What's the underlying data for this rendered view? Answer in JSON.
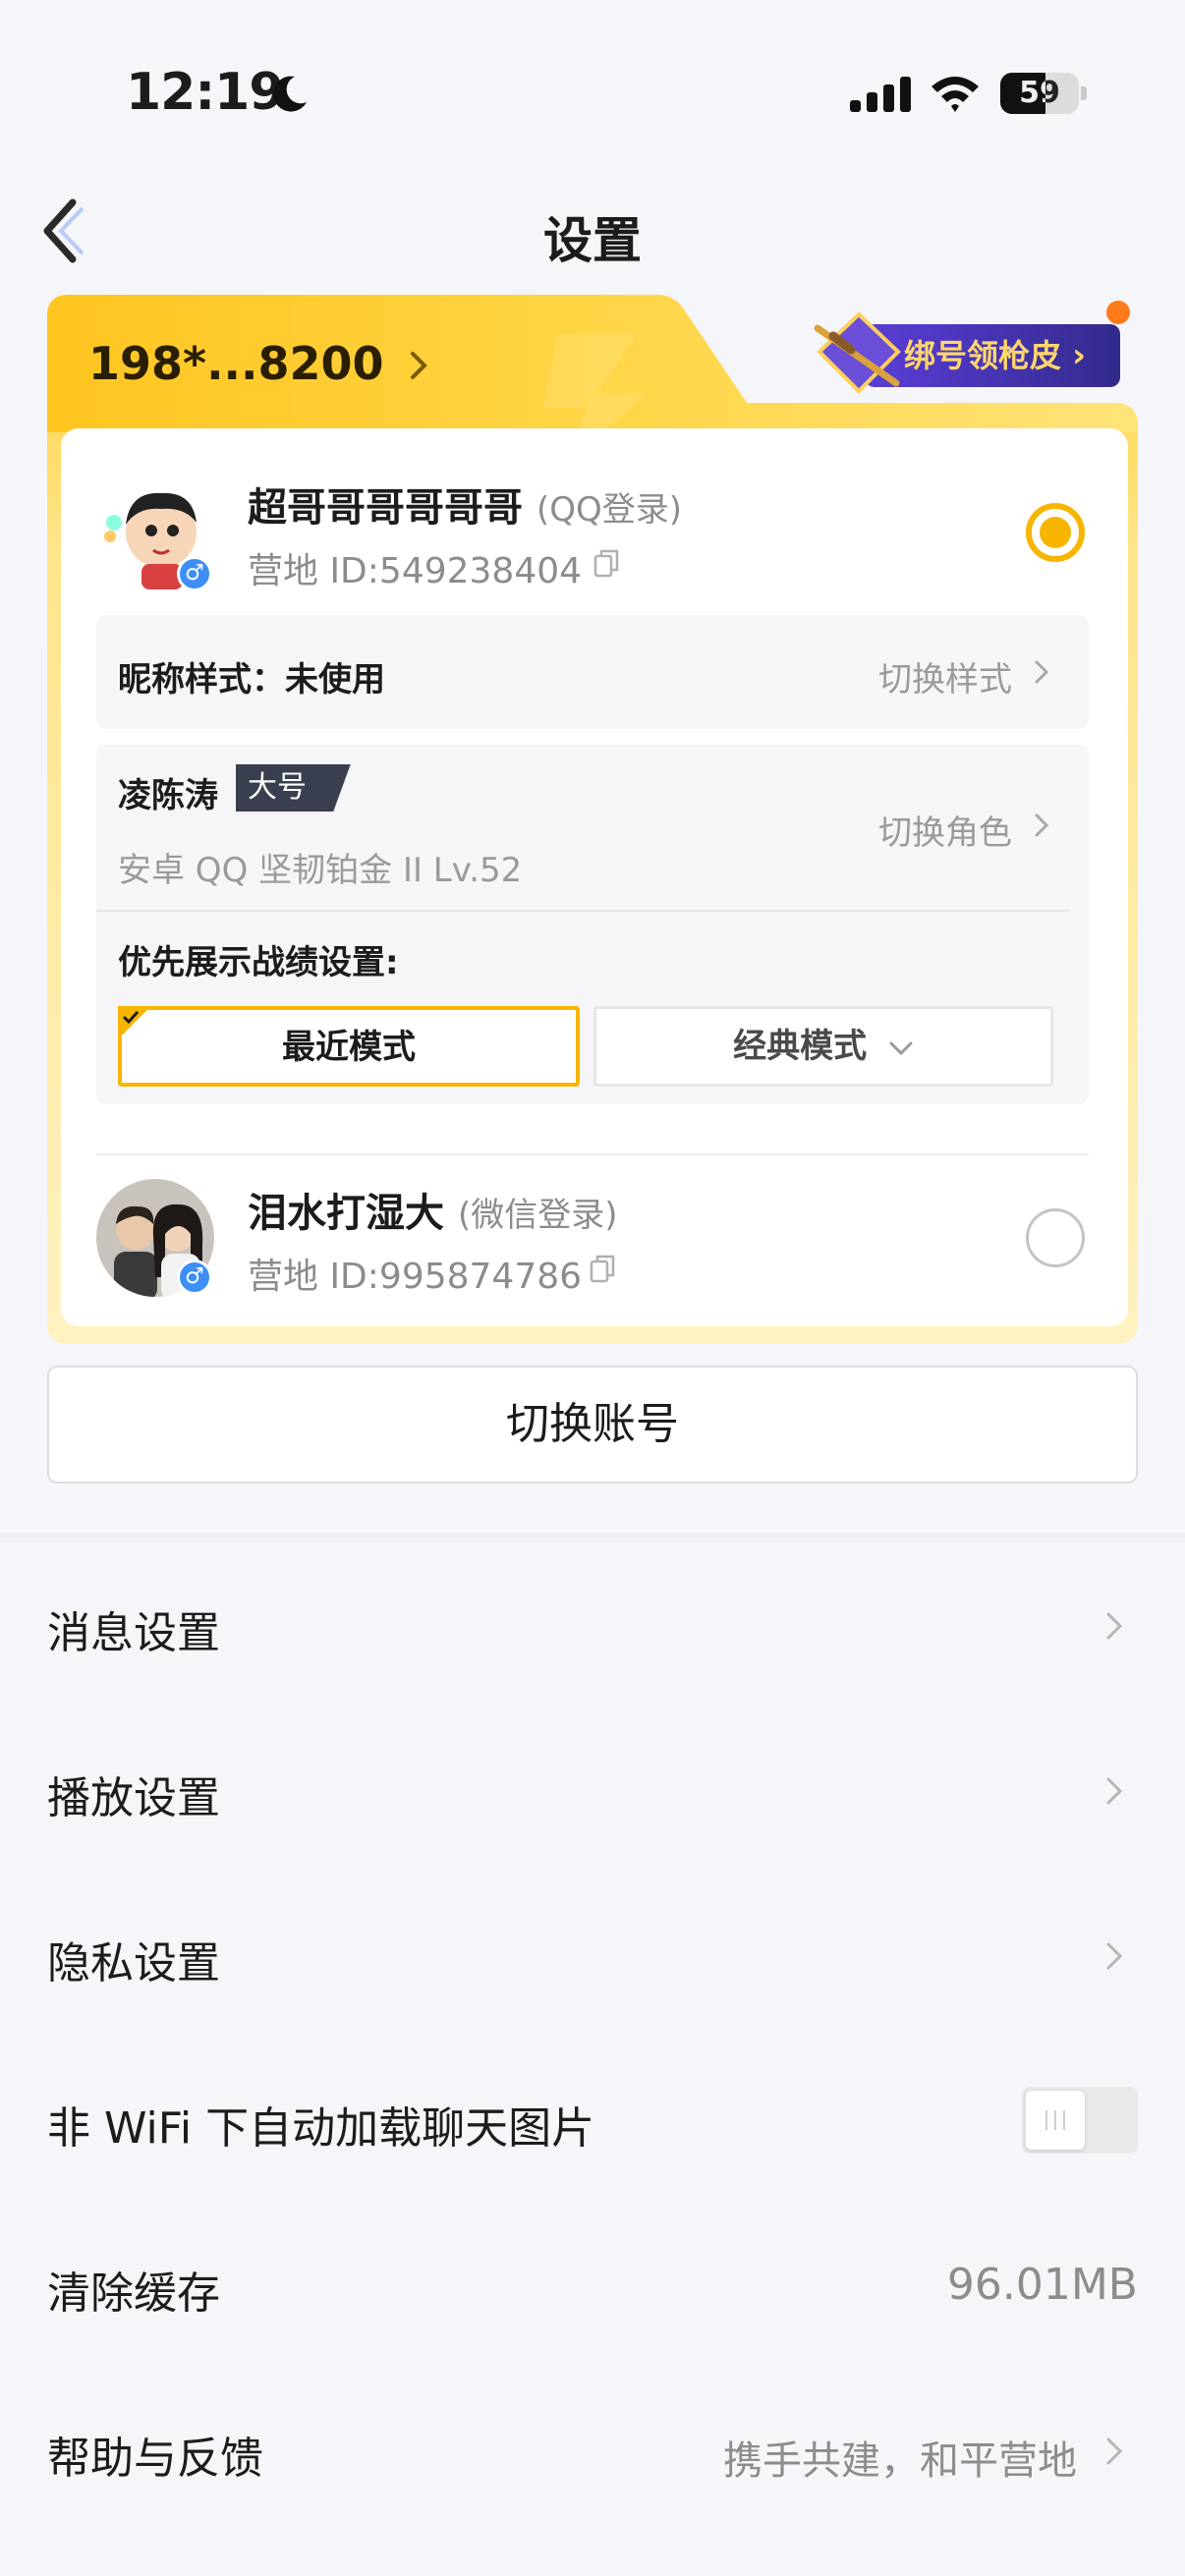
{
  "status_bar": {
    "time": "12:19",
    "battery": "59"
  },
  "header": {
    "title": "设置"
  },
  "card": {
    "phone": "198*...8200",
    "bind_promo": "绑号领枪皮",
    "accounts": [
      {
        "name": "超哥哥哥哥哥哥",
        "login": "(QQ登录)",
        "id": "营地 ID:549238404",
        "gender": "♂",
        "selected": true
      },
      {
        "name": "泪水打湿大",
        "login": "(微信登录)",
        "id": "营地 ID:995874786",
        "gender": "♂",
        "selected": false
      }
    ],
    "nickname_style": {
      "label": "昵称样式：未使用",
      "action": "切换样式"
    },
    "role": {
      "name": "凌陈涛",
      "badge": "大号",
      "detail": "安卓 QQ  坚韧铂金 II  Lv.52",
      "action": "切换角色"
    },
    "record_setting": {
      "label": "优先展示战绩设置:",
      "modes": [
        "最近模式",
        "经典模式"
      ],
      "active_mode": "最近模式"
    }
  },
  "switch_account": "切换账号",
  "settings": [
    {
      "label": "消息设置",
      "value": ""
    },
    {
      "label": "播放设置",
      "value": ""
    },
    {
      "label": "隐私设置",
      "value": ""
    },
    {
      "label": "非 WiFi 下自动加载聊天图片",
      "toggle": false
    },
    {
      "label": "清除缓存",
      "value": "96.01MB"
    },
    {
      "label": "帮助与反馈",
      "value": "携手共建，和平营地"
    }
  ],
  "colors": {
    "accent": "#f7b500",
    "card_gradient_start": "#ffd23c",
    "card_gradient_end": "#fff0b3"
  }
}
